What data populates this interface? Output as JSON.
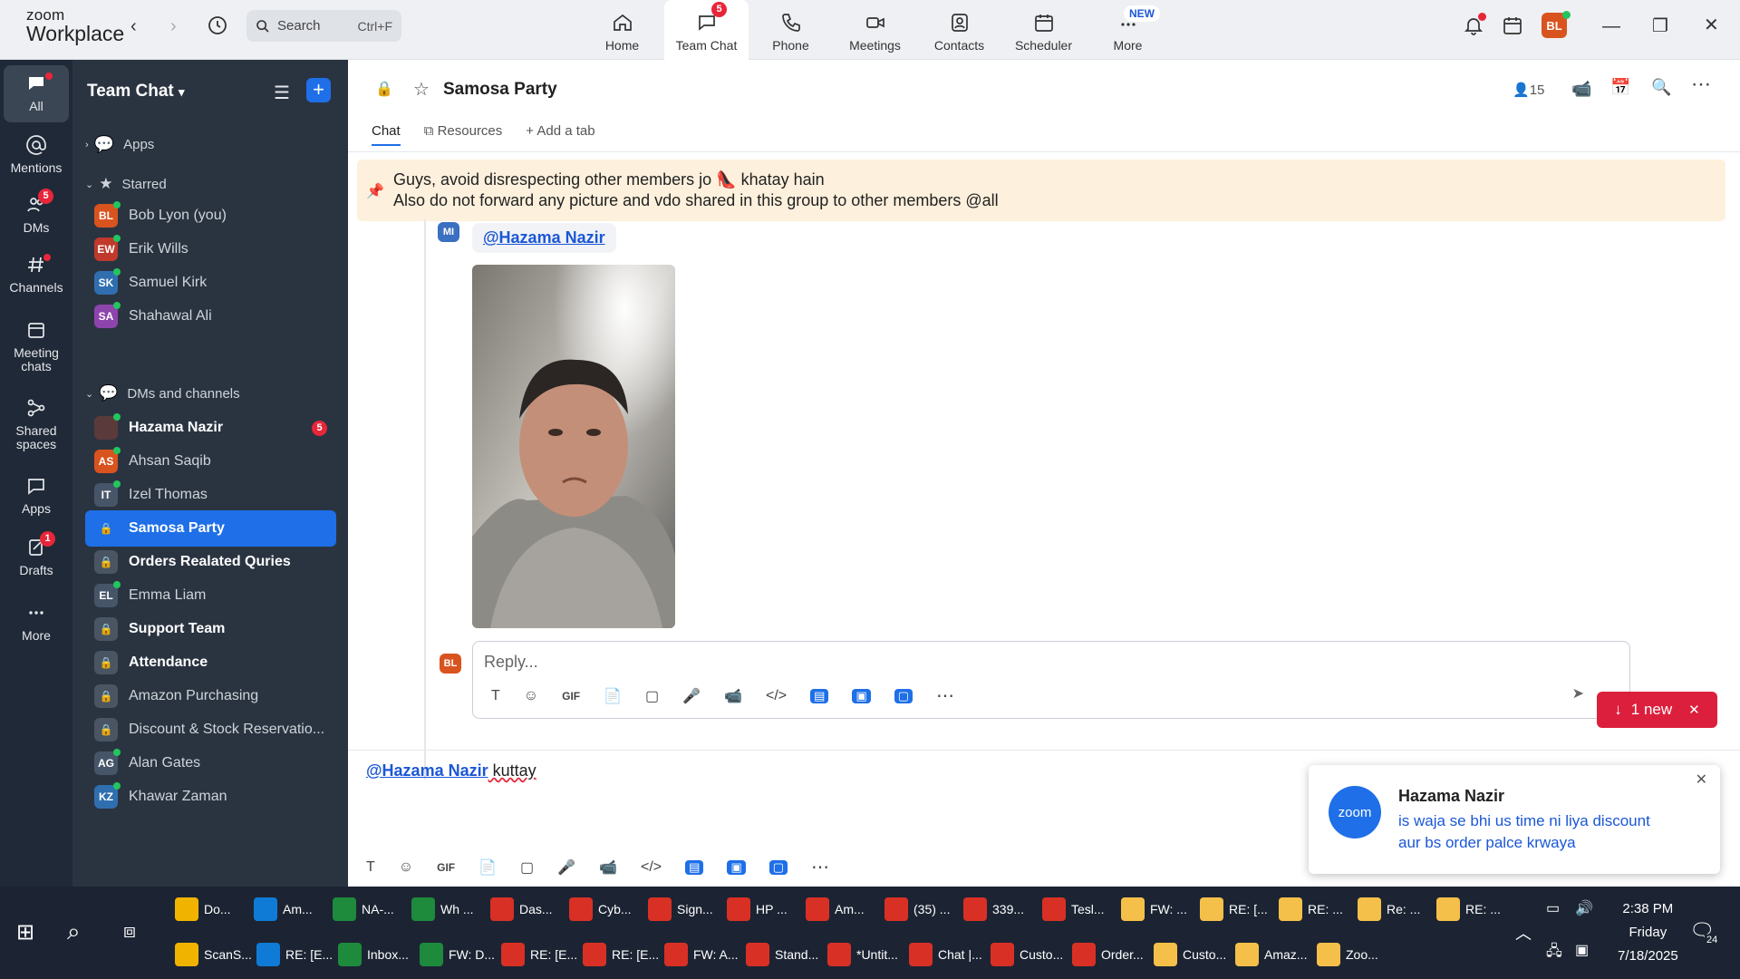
{
  "app": {
    "brand_top": "zoom",
    "brand_bottom": "Workplace"
  },
  "search": {
    "placeholder": "Search",
    "shortcut": "Ctrl+F"
  },
  "nav_tabs": [
    {
      "label": "Home"
    },
    {
      "label": "Team Chat",
      "badge": "5"
    },
    {
      "label": "Phone"
    },
    {
      "label": "Meetings"
    },
    {
      "label": "Contacts"
    },
    {
      "label": "Scheduler"
    },
    {
      "label": "More",
      "tag": "NEW"
    }
  ],
  "user_avatar": "BL",
  "rail": [
    {
      "label": "All"
    },
    {
      "label": "Mentions"
    },
    {
      "label": "DMs",
      "badge": "5"
    },
    {
      "label": "Channels"
    },
    {
      "label": "Meeting chats"
    },
    {
      "label": "Shared spaces"
    },
    {
      "label": "Apps"
    },
    {
      "label": "Drafts",
      "badge": "1"
    },
    {
      "label": "More"
    }
  ],
  "sidebar": {
    "title": "Team Chat",
    "apps_label": "Apps",
    "starred_label": "Starred",
    "starred": [
      {
        "initials": "BL",
        "name": "Bob Lyon (you)",
        "color": "#d9531e"
      },
      {
        "initials": "EW",
        "name": "Erik Wills",
        "color": "#c0392b"
      },
      {
        "initials": "SK",
        "name": "Samuel Kirk",
        "color": "#2f6fb0"
      },
      {
        "initials": "SA",
        "name": "Shahawal Ali",
        "color": "#8e44ad"
      }
    ],
    "dms_label": "DMs and channels",
    "dms": [
      {
        "initials": "",
        "name": "Hazama Nazir",
        "badge": "5",
        "bold": true,
        "color": "#5a3a3a"
      },
      {
        "initials": "AS",
        "name": "Ahsan Saqib",
        "color": "#d9531e"
      },
      {
        "initials": "IT",
        "name": "Izel Thomas",
        "color": "#475569"
      },
      {
        "initials": "",
        "name": "Samosa Party",
        "selected": true,
        "lock": true
      },
      {
        "initials": "",
        "name": "Orders Realated Quries",
        "bold": true,
        "lock": true
      },
      {
        "initials": "EL",
        "name": "Emma Liam",
        "color": "#475569"
      },
      {
        "initials": "",
        "name": "Support Team",
        "bold": true,
        "lock": true
      },
      {
        "initials": "",
        "name": "Attendance",
        "bold": true,
        "lock": true
      },
      {
        "initials": "",
        "name": "Amazon Purchasing",
        "lock": true
      },
      {
        "initials": "",
        "name": "Discount & Stock Reservatio...",
        "lock": true
      },
      {
        "initials": "AG",
        "name": "Alan Gates",
        "color": "#475569"
      },
      {
        "initials": "KZ",
        "name": "Khawar Zaman",
        "color": "#2f6fb0"
      }
    ]
  },
  "channel": {
    "name": "Samosa Party",
    "members": "15",
    "tabs": [
      "Chat",
      "Resources",
      "Add a tab"
    ],
    "pinned_line1": "Guys, avoid disrespecting other members jo 👠 khatay hain",
    "pinned_line2": "Also do not forward any picture and vdo shared in this group to other members @all"
  },
  "message": {
    "sender_initials": "MI",
    "mention": "@Hazama Nazir"
  },
  "composer": {
    "avatar": "BL",
    "placeholder": "Reply...",
    "tools": [
      "T",
      "☺",
      "GIF",
      "📄",
      "▢",
      "🎤",
      "📹",
      "</>"
    ]
  },
  "new_pill": "1 new",
  "draft": {
    "mention": "@Hazama Nazir",
    "text": " kuttay"
  },
  "toast": {
    "app": "zoom",
    "sender": "Hazama Nazir",
    "line1": "is waja se bhi us time ni liya discount",
    "line2": "aur bs order palce krwaya"
  },
  "taskbar": {
    "row1": [
      "Do...",
      "Am...",
      "NA-...",
      "Wh ...",
      "Das...",
      "Cyb...",
      "Sign...",
      "HP ...",
      "Am...",
      "(35) ...",
      "339...",
      "Tesl...",
      "FW: ...",
      "RE: [...",
      "RE: ...",
      "Re: ...",
      "RE: ..."
    ],
    "row2": [
      "ScanS...",
      "RE: [E...",
      "Inbox...",
      "FW: D...",
      "RE: [E...",
      "RE: [E...",
      "FW: A...",
      "Stand...",
      "*Untit...",
      "Chat |...",
      "Custo...",
      "Order...",
      "Custo...",
      "Amaz...",
      "Zoo..."
    ],
    "time": "2:38 PM",
    "day": "Friday",
    "date": "7/18/2025",
    "notif_count": "24"
  }
}
